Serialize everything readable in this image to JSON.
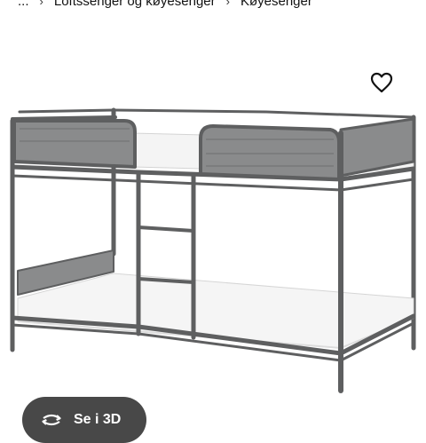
{
  "breadcrumb": {
    "items": [
      {
        "label": "..."
      },
      {
        "label": "Loftssenger og køyesenger"
      },
      {
        "label": "Køyesenger"
      }
    ],
    "separator_icon": "chevron-right-icon"
  },
  "favorite": {
    "icon": "heart-outline-icon"
  },
  "product_image": {
    "description_icon": "bunk-bed-image",
    "frame_color": "#5e5f60",
    "mattress_color": "#f4f4f4"
  },
  "view_3d": {
    "label": "Se i 3D",
    "icon": "rotate-3d-icon",
    "background": "#484848"
  }
}
